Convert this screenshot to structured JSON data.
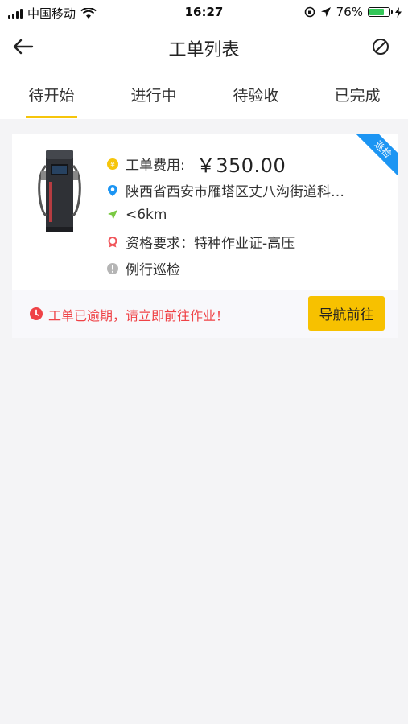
{
  "status_bar": {
    "carrier": "中国移动",
    "time": "16:27",
    "battery_percent": "76%",
    "battery_level": 0.76,
    "icons": [
      "signal-icon",
      "wifi-icon",
      "rotation-lock-icon",
      "location-arrow-icon",
      "battery-icon",
      "charging-icon"
    ]
  },
  "navbar": {
    "title": "工单列表",
    "back_icon": "arrow-left-icon",
    "right_icon": "prohibited-icon"
  },
  "tabs": [
    {
      "label": "待开始",
      "active": true
    },
    {
      "label": "进行中",
      "active": false
    },
    {
      "label": "待验收",
      "active": false
    },
    {
      "label": "已完成",
      "active": false
    }
  ],
  "order_card": {
    "ribbon_tag": "巡检",
    "fee_label": "工单费用:",
    "fee_value": "￥350.00",
    "address": "陕西省西安市雁塔区丈八沟街道科…",
    "distance": "<6km",
    "qualification": "资格要求：特种作业证-高压",
    "type": "例行巡检",
    "alert_text": "工单已逾期，请立即前往作业！",
    "navigate_button": "导航前往"
  },
  "colors": {
    "accent_yellow": "#f7c100",
    "tab_underline": "#f6c50b",
    "alert_red": "#ef4246",
    "ribbon_blue": "#1c95f3",
    "location_blue": "#1c95f3",
    "distance_green": "#7ac943",
    "badge_red": "#f0555a",
    "info_gray": "#b5b5b5",
    "background": "#f4f4f6"
  }
}
